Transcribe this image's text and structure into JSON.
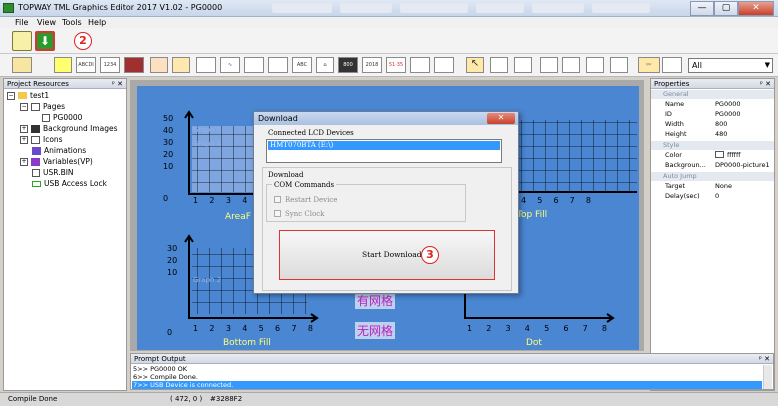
{
  "title": "TOPWAY TML Graphics Editor 2017 V1.02 - PG0000",
  "window_buttons": {
    "min": "—",
    "max": "▢",
    "close": "✕"
  },
  "menu": [
    "File",
    "View",
    "Tools",
    "Help"
  ],
  "step_markers": {
    "two": "2",
    "three": "3"
  },
  "toolbar_icon_labels": {
    "abcd": "ABCDI",
    "n1234": "1234",
    "n2018": "2018",
    "n5135": "51·35",
    "abc": "ABC",
    "n800": "800"
  },
  "select_all": {
    "value": "All"
  },
  "project": {
    "header": "Project Resources",
    "pin": "ᵖ ✕",
    "root": "test1",
    "pages": "Pages",
    "pg": "PG0000",
    "items": [
      "Background Images",
      "Icons",
      "Animations",
      "Variables(VP)",
      "USR.BIN",
      "USB Access Lock"
    ]
  },
  "canvas": {
    "y_ticks": [
      "50",
      "40",
      "30",
      "20",
      "10",
      "0"
    ],
    "x_ticks": [
      "1",
      "2",
      "3",
      "4",
      "5",
      "6",
      "7",
      "8"
    ],
    "graph0": "Graph 0",
    "graph4": "Graph 4",
    "graph2": "Graph 2",
    "area_fill": "AreaF",
    "top_fill": "Top Fill",
    "bottom_fill": "Bottom Fill",
    "dot": "Dot",
    "grid_cn": "有网格",
    "nogrid_cn": "无网格"
  },
  "dialog": {
    "title": "Download",
    "close": "✕",
    "connected": "Connected LCD Devices",
    "device": "HMT070BTA (E:\\)",
    "download": "Download",
    "com": "COM Commands",
    "restart": "Restart Device",
    "sync": "Sync Clock",
    "start": "Start Download"
  },
  "properties": {
    "header": "Properties",
    "pin": "ᵖ ✕",
    "general": "General",
    "name_k": "Name",
    "name_v": "PG0000",
    "id_k": "ID",
    "id_v": "PG0000",
    "width_k": "Width",
    "width_v": "800",
    "height_k": "Height",
    "height_v": "480",
    "style": "Style",
    "color_k": "Color",
    "color_v": "ffffff",
    "bg_k": "Backgroun...",
    "bg_v": "DP0000-picture1",
    "autojump": "Auto Jump",
    "target_k": "Target",
    "target_v": "None",
    "delay_k": "Delay(sec)",
    "delay_v": "0"
  },
  "prompt": {
    "header": "Prompt Output",
    "pin": "ᵖ ✕",
    "lines": [
      "5>> PG0000   OK",
      "6>> Compile Done.",
      "7>> USB Device is connected."
    ]
  },
  "status": {
    "left": "Compile Done",
    "coords": "( 472, 0 )",
    "color": "#3288F2"
  }
}
